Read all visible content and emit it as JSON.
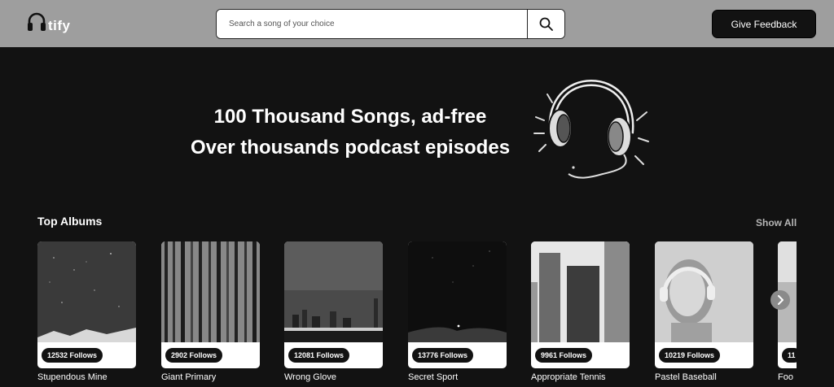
{
  "navbar": {
    "logo_text": "tify",
    "logo_icon": "headphones-icon",
    "search_placeholder": "Search a song of your choice",
    "search_icon": "search-icon",
    "feedback_label": "Give Feedback"
  },
  "hero": {
    "line1": "100 Thousand Songs, ad-free",
    "line2": "Over thousands podcast episodes",
    "image_icon": "headphones-illustration"
  },
  "top_albums": {
    "title": "Top Albums",
    "show_all": "Show All",
    "next_icon": "chevron-right-icon",
    "items": [
      {
        "follows": "12532 Follows",
        "name": "Stupendous Mine"
      },
      {
        "follows": "2902 Follows",
        "name": "Giant Primary"
      },
      {
        "follows": "12081 Follows",
        "name": "Wrong Glove"
      },
      {
        "follows": "13776 Follows",
        "name": "Secret Sport"
      },
      {
        "follows": "9961 Follows",
        "name": "Appropriate Tennis"
      },
      {
        "follows": "10219 Follows",
        "name": "Pastel Baseball"
      },
      {
        "follows": "11",
        "name": "Foo"
      }
    ]
  },
  "colors": {
    "background": "#121212",
    "navbar": "#9e9e9e",
    "card": "#ffffff",
    "muted": "#b5b5b5"
  }
}
